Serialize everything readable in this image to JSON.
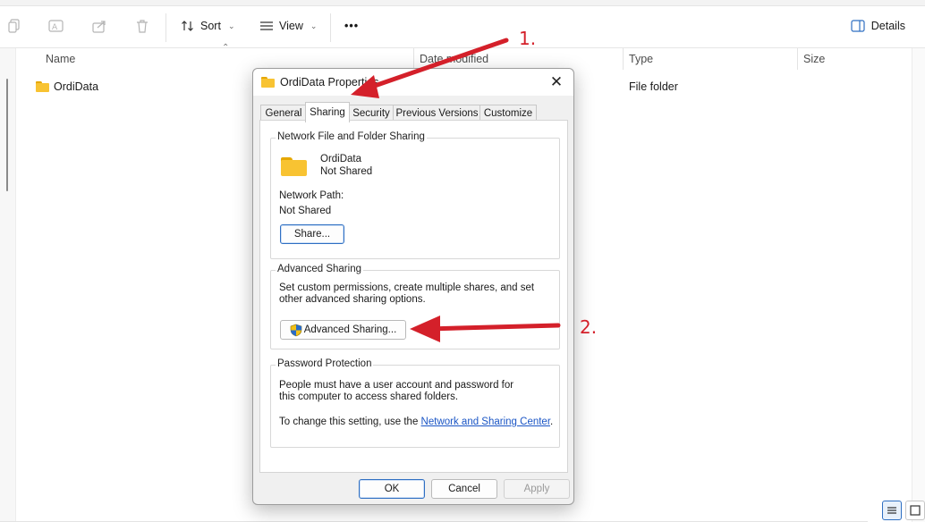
{
  "toolbar": {
    "sort_label": "Sort",
    "view_label": "View",
    "more_label": "•••",
    "details_label": "Details"
  },
  "columns": {
    "name": "Name",
    "date_modified": "Date modified",
    "type": "Type",
    "size": "Size"
  },
  "files": [
    {
      "name": "OrdiData",
      "type": "File folder"
    }
  ],
  "dialog": {
    "title": "OrdiData Properties",
    "close_glyph": "✕",
    "tabs": [
      "General",
      "Sharing",
      "Security",
      "Previous Versions",
      "Customize"
    ],
    "active_tab": "Sharing",
    "network_sharing": {
      "label": "Network File and Folder Sharing",
      "folder_name": "OrdiData",
      "share_status": "Not Shared",
      "network_path_label": "Network Path:",
      "network_path_value": "Not Shared",
      "share_button": "Share..."
    },
    "advanced_sharing": {
      "label": "Advanced Sharing",
      "description": "Set custom permissions, create multiple shares, and set other advanced sharing options.",
      "button": "Advanced Sharing..."
    },
    "password_protection": {
      "label": "Password Protection",
      "description": "People must have a user account and password for this computer to access shared folders.",
      "change_prefix": "To change this setting, use the ",
      "link_text": "Network and Sharing Center",
      "change_suffix": "."
    },
    "buttons": {
      "ok": "OK",
      "cancel": "Cancel",
      "apply": "Apply"
    }
  },
  "annotations": {
    "step1": "1.",
    "step2": "2.",
    "color": "#d4202a"
  },
  "icons": {
    "copy": "copy-icon",
    "rename": "rename-icon",
    "share": "share-icon",
    "delete": "trash-icon",
    "sort": "sort-arrows-icon",
    "view": "view-lines-icon",
    "details": "details-pane-icon",
    "folder": "folder-icon",
    "shield": "uac-shield-icon"
  }
}
